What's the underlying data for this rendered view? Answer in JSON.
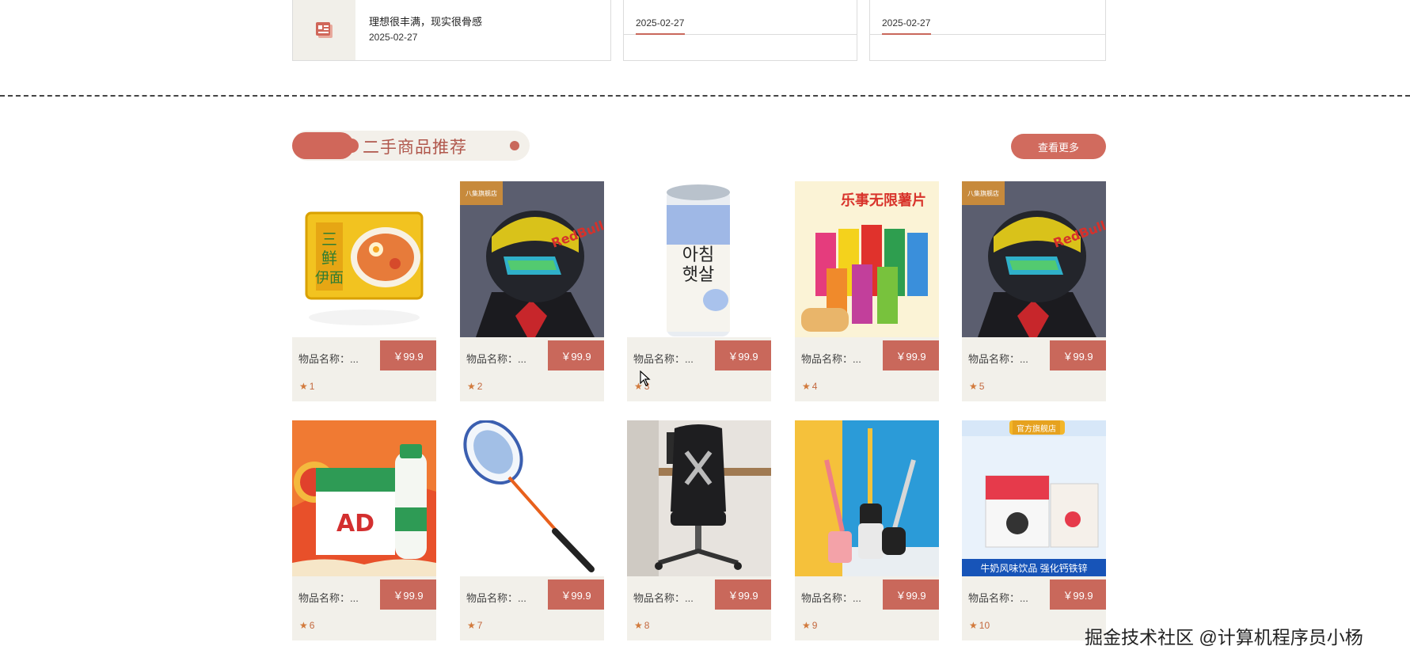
{
  "news": [
    {
      "title": "理想很丰满，现实很骨感",
      "date": "2025-02-27"
    },
    {
      "title": "",
      "date": "2025-02-27"
    },
    {
      "title": "",
      "date": "2025-02-27"
    }
  ],
  "section": {
    "title": "二手商品推荐",
    "more_label": "查看更多"
  },
  "products": [
    {
      "name": "物品名称：...",
      "price": "￥99.9",
      "rank": "1",
      "image": "instant-noodles"
    },
    {
      "name": "物品名称：...",
      "price": "￥99.9",
      "rank": "2",
      "image": "helmet-rider",
      "store_tag": "八集旗舰店"
    },
    {
      "name": "物品名称：...",
      "price": "￥99.9",
      "rank": "3",
      "image": "drink-can"
    },
    {
      "name": "物品名称：...",
      "price": "￥99.9",
      "rank": "4",
      "image": "chips-bags"
    },
    {
      "name": "物品名称：...",
      "price": "￥99.9",
      "rank": "5",
      "image": "helmet-rider",
      "store_tag": "八集旗舰店"
    },
    {
      "name": "物品名称：...",
      "price": "￥99.9",
      "rank": "6",
      "image": "ad-milk-drink"
    },
    {
      "name": "物品名称：...",
      "price": "￥99.9",
      "rank": "7",
      "image": "badminton-racket"
    },
    {
      "name": "物品名称：...",
      "price": "￥99.9",
      "rank": "8",
      "image": "office-chair"
    },
    {
      "name": "物品名称：...",
      "price": "￥99.9",
      "rank": "9",
      "image": "toilet-brush"
    },
    {
      "name": "物品名称：...",
      "price": "￥99.9",
      "rank": "10",
      "image": "milk-drink-box",
      "store_tag": "官方旗舰店",
      "banner": "牛奶风味饮品 强化钙铁锌"
    }
  ],
  "watermark": "掘金技术社区 @计算机程序员小杨",
  "colors": {
    "accent": "#c9685b",
    "card_bg": "#f2f0ea"
  }
}
